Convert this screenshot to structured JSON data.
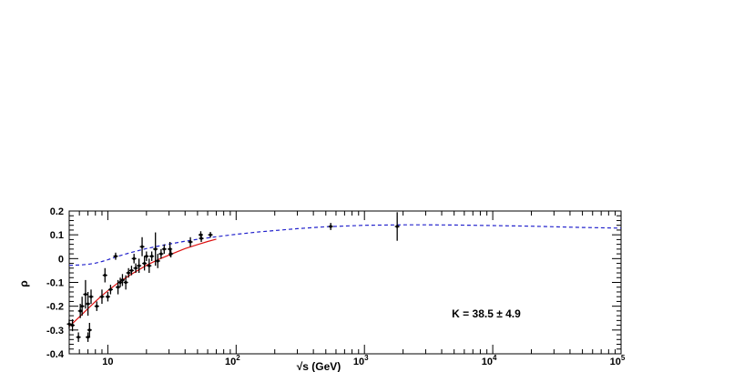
{
  "chart_data": {
    "type": "scatter",
    "title": "",
    "xlabel": "√s (GeV)",
    "ylabel": "ρ",
    "x_scale": "log",
    "xlim": [
      5,
      100000
    ],
    "ylim": [
      -0.4,
      0.2
    ],
    "grid": false,
    "legend": "none",
    "x_ticks": [
      {
        "value": 10,
        "label": "10"
      },
      {
        "value": 100,
        "label": "10",
        "sup": "2"
      },
      {
        "value": 1000,
        "label": "10",
        "sup": "3"
      },
      {
        "value": 10000,
        "label": "10",
        "sup": "4"
      },
      {
        "value": 100000,
        "label": "10",
        "sup": "5"
      }
    ],
    "y_ticks": [
      {
        "value": 0.2,
        "label": "0.2"
      },
      {
        "value": 0.1,
        "label": "0.1"
      },
      {
        "value": 0,
        "label": "0"
      },
      {
        "value": -0.1,
        "label": "-0.1"
      },
      {
        "value": -0.2,
        "label": "-0.2"
      },
      {
        "value": -0.3,
        "label": "-0.3"
      },
      {
        "value": -0.4,
        "label": "-0.4"
      }
    ],
    "annotation": "K = 38.5 ± 4.9",
    "colors": {
      "pp_curve": "#2222cc",
      "pbarp_curve": "#dd1111",
      "points": "#000000"
    },
    "series": [
      {
        "style": "dashed",
        "color": "#2222cc",
        "x": [
          5,
          6,
          7,
          8,
          9,
          10,
          12,
          15,
          20,
          25,
          30,
          40,
          50,
          70,
          100,
          150,
          200,
          300,
          500,
          1000,
          2000,
          3000,
          5000,
          10000,
          20000,
          50000,
          100000
        ],
        "y": [
          -0.028,
          -0.027,
          -0.024,
          -0.019,
          -0.012,
          -0.005,
          0.01,
          0.025,
          0.042,
          0.053,
          0.061,
          0.073,
          0.081,
          0.092,
          0.102,
          0.112,
          0.118,
          0.126,
          0.134,
          0.14,
          0.142,
          0.142,
          0.141,
          0.139,
          0.136,
          0.131,
          0.128
        ]
      },
      {
        "style": "solid",
        "color": "#dd1111",
        "x": [
          5,
          6,
          7,
          8,
          9,
          10,
          12,
          15,
          20,
          25,
          30,
          40,
          50,
          60,
          70
        ],
        "y": [
          -0.285,
          -0.245,
          -0.21,
          -0.18,
          -0.155,
          -0.135,
          -0.102,
          -0.068,
          -0.028,
          -0.003,
          0.015,
          0.042,
          0.059,
          0.072,
          0.082
        ]
      },
      {
        "style": "points",
        "color": "#000000",
        "points": [
          {
            "x": 5.0,
            "y": -0.275,
            "e": 0.02
          },
          {
            "x": 5.3,
            "y": -0.28,
            "e": 0.025
          },
          {
            "x": 5.9,
            "y": -0.33,
            "e": 0.02
          },
          {
            "x": 6.1,
            "y": -0.22,
            "e": 0.03
          },
          {
            "x": 6.3,
            "y": -0.2,
            "e": 0.04
          },
          {
            "x": 6.7,
            "y": -0.15,
            "e": 0.06
          },
          {
            "x": 7.0,
            "y": -0.19,
            "e": 0.05
          },
          {
            "x": 7.2,
            "y": -0.3,
            "e": 0.03
          },
          {
            "x": 7.4,
            "y": -0.16,
            "e": 0.03
          },
          {
            "x": 7.0,
            "y": -0.33,
            "e": 0.02
          },
          {
            "x": 8.2,
            "y": -0.2,
            "e": 0.02
          },
          {
            "x": 9.0,
            "y": -0.16,
            "e": 0.03
          },
          {
            "x": 9.5,
            "y": -0.07,
            "e": 0.03
          },
          {
            "x": 10.0,
            "y": -0.16,
            "e": 0.02
          },
          {
            "x": 10.5,
            "y": -0.13,
            "e": 0.02
          },
          {
            "x": 11.5,
            "y": 0.01,
            "e": 0.015
          },
          {
            "x": 12.0,
            "y": -0.12,
            "e": 0.03
          },
          {
            "x": 12.5,
            "y": -0.1,
            "e": 0.02
          },
          {
            "x": 13.0,
            "y": -0.09,
            "e": 0.025
          },
          {
            "x": 13.8,
            "y": -0.1,
            "e": 0.03
          },
          {
            "x": 14.5,
            "y": -0.06,
            "e": 0.02
          },
          {
            "x": 15.3,
            "y": -0.05,
            "e": 0.02
          },
          {
            "x": 16.0,
            "y": 0.0,
            "e": 0.02
          },
          {
            "x": 16.5,
            "y": -0.04,
            "e": 0.02
          },
          {
            "x": 17.5,
            "y": -0.03,
            "e": 0.03
          },
          {
            "x": 18.5,
            "y": 0.05,
            "e": 0.04
          },
          {
            "x": 19.3,
            "y": -0.02,
            "e": 0.03
          },
          {
            "x": 20.0,
            "y": 0.01,
            "e": 0.02
          },
          {
            "x": 21.0,
            "y": -0.03,
            "e": 0.03
          },
          {
            "x": 22.0,
            "y": 0.01,
            "e": 0.02
          },
          {
            "x": 23.5,
            "y": 0.04,
            "e": 0.07
          },
          {
            "x": 24.5,
            "y": -0.01,
            "e": 0.03
          },
          {
            "x": 26.0,
            "y": 0.02,
            "e": 0.02
          },
          {
            "x": 27.5,
            "y": 0.04,
            "e": 0.02
          },
          {
            "x": 30.5,
            "y": 0.04,
            "e": 0.03
          },
          {
            "x": 31.0,
            "y": 0.02,
            "e": 0.015
          },
          {
            "x": 44.0,
            "y": 0.07,
            "e": 0.02
          },
          {
            "x": 53.0,
            "y": 0.1,
            "e": 0.015
          },
          {
            "x": 53.5,
            "y": 0.085,
            "e": 0.015
          },
          {
            "x": 63.0,
            "y": 0.1,
            "e": 0.012
          },
          {
            "x": 546.0,
            "y": 0.135,
            "e": 0.015
          },
          {
            "x": 1800.0,
            "y": 0.135,
            "e": 0.06
          }
        ]
      }
    ]
  }
}
